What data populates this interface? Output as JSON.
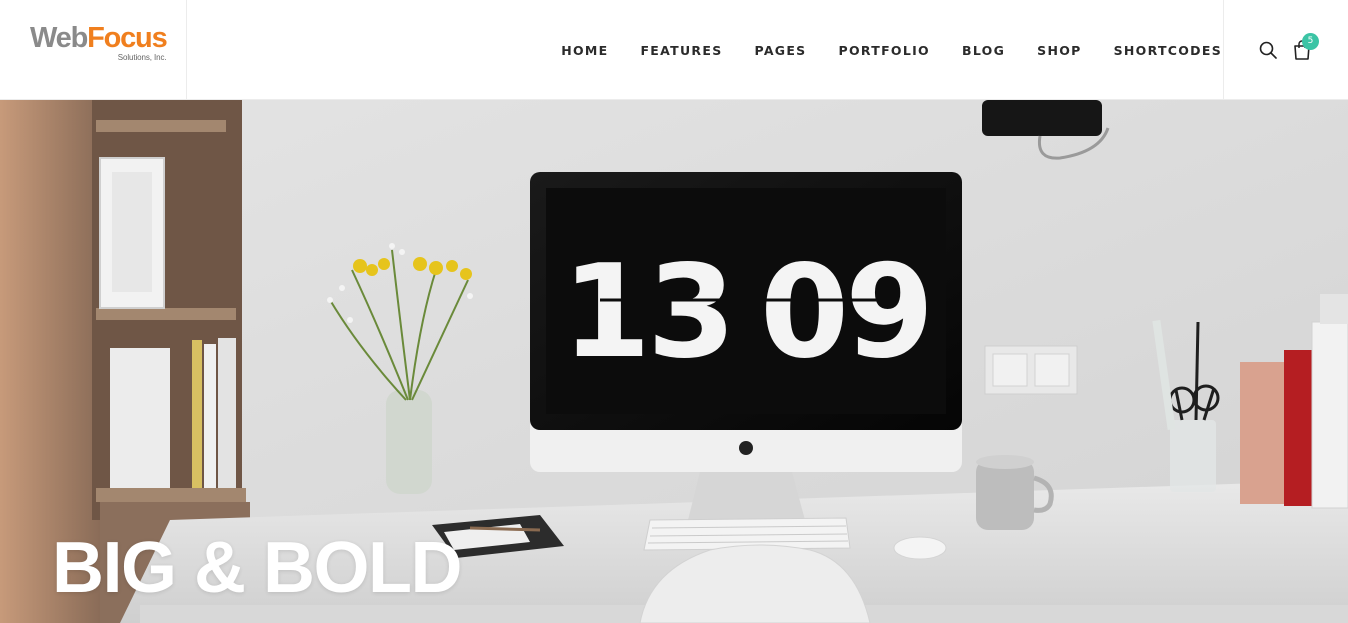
{
  "brand": {
    "word_1": "Web",
    "word_2": "Focus",
    "tagline": "Solutions, Inc."
  },
  "nav": {
    "items": [
      {
        "label": "HOME"
      },
      {
        "label": "FEATURES"
      },
      {
        "label": "PAGES"
      },
      {
        "label": "PORTFOLIO"
      },
      {
        "label": "BLOG"
      },
      {
        "label": "SHOP"
      },
      {
        "label": "SHORTCODES"
      }
    ]
  },
  "tools": {
    "search_icon": "search-icon",
    "cart_icon": "shopping-bag-icon",
    "cart_count": "5"
  },
  "hero": {
    "title": "BIG & BOLD",
    "clock_hours": "13",
    "clock_minutes": "09"
  },
  "colors": {
    "accent": "#f07f1e",
    "badge": "#3bc4a5",
    "nav_text": "#2b2b2b"
  }
}
